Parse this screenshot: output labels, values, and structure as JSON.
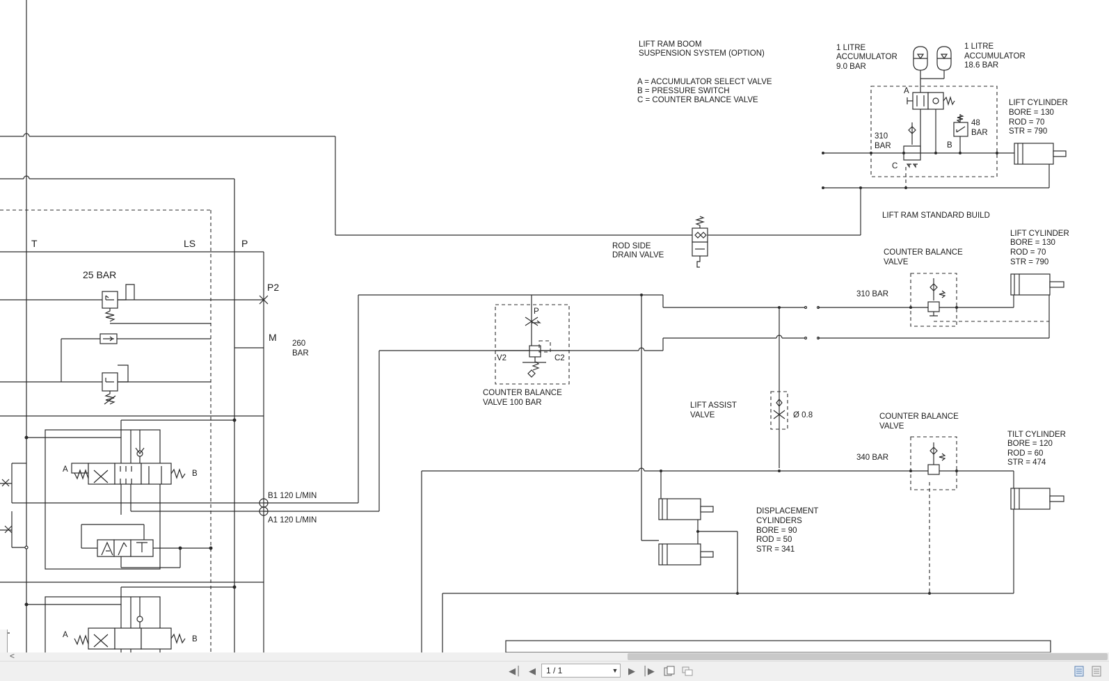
{
  "diagram": {
    "labels": {
      "lift_ram_boom_1": "LIFT RAM BOOM",
      "lift_ram_boom_2": "SUSPENSION SYSTEM (OPTION)",
      "legend_a": "A = ACCUMULATOR SELECT VALVE",
      "legend_b": "B = PRESSURE SWITCH",
      "legend_c": "C = COUNTER BALANCE VALVE",
      "acc1_1": "1 LITRE",
      "acc1_2": "ACCUMULATOR",
      "acc1_3": "9.0 BAR",
      "acc2_1": "1 LITRE",
      "acc2_2": "ACCUMULATOR",
      "acc2_3": "18.6 BAR",
      "lift_cyl1_1": "LIFT CYLINDER",
      "lift_cyl1_2": "BORE = 130",
      "lift_cyl1_3": "ROD  =  70",
      "lift_cyl1_4": "STR  = 790",
      "letter_a_top": "A",
      "bar48_1": "48",
      "bar48_2": "BAR",
      "letter_b_top": "B",
      "bar310_1": "310",
      "bar310_2": "BAR",
      "letter_c": "C",
      "lift_ram_std": "LIFT RAM STANDARD BUILD",
      "rod_side_1": "ROD SIDE",
      "rod_side_2": "DRAIN VALVE",
      "cbv_a_1": "COUNTER BALANCE",
      "cbv_a_2": "VALVE",
      "bar310b": "310 BAR",
      "lift_cyl2_1": "LIFT CYLINDER",
      "lift_cyl2_2": "BORE = 130",
      "lift_cyl2_3": "ROD  =  70",
      "lift_cyl2_4": "STR  = 790",
      "port_p": "P",
      "port_v2": "V2",
      "port_c2": "C2",
      "cbv100_1": "COUNTER BALANCE",
      "cbv100_2": "VALVE 100 BAR",
      "lift_assist_1": "LIFT ASSIST",
      "lift_assist_2": "VALVE",
      "orifice": "Ø 0.8",
      "cbv_b_1": "COUNTER BALANCE",
      "cbv_b_2": "VALVE",
      "bar340": "340 BAR",
      "tilt_1": "TILT CYLINDER",
      "tilt_2": "BORE = 120",
      "tilt_3": "ROD  = 60",
      "tilt_4": "STR  = 474",
      "disp_1": "DISPLACEMENT",
      "disp_2": "CYLINDERS",
      "disp_3": "BORE =  90",
      "disp_4": "ROD  =  50",
      "disp_5": "STR  = 341",
      "bar25": "25 BAR",
      "port_p2": "P2",
      "port_m": "M",
      "bar260_1": "260",
      "bar260_2": "BAR",
      "col_t": "T",
      "col_ls": "LS",
      "col_p": "P",
      "b1": "B1 120 L/MIN",
      "a1": "A1 120 L/MIN",
      "spool_a1": "A",
      "spool_b1": "B",
      "spool_a2": "A",
      "spool_b2": "B"
    }
  },
  "viewer": {
    "page_display": "1 / 1",
    "scroll_left_glyph": "<",
    "icons": [
      "first-page-icon",
      "previous-page-icon",
      "next-page-icon",
      "last-page-icon",
      "fit-page-icon",
      "fit-width-icon",
      "single-page-view-icon",
      "continuous-view-icon"
    ]
  }
}
